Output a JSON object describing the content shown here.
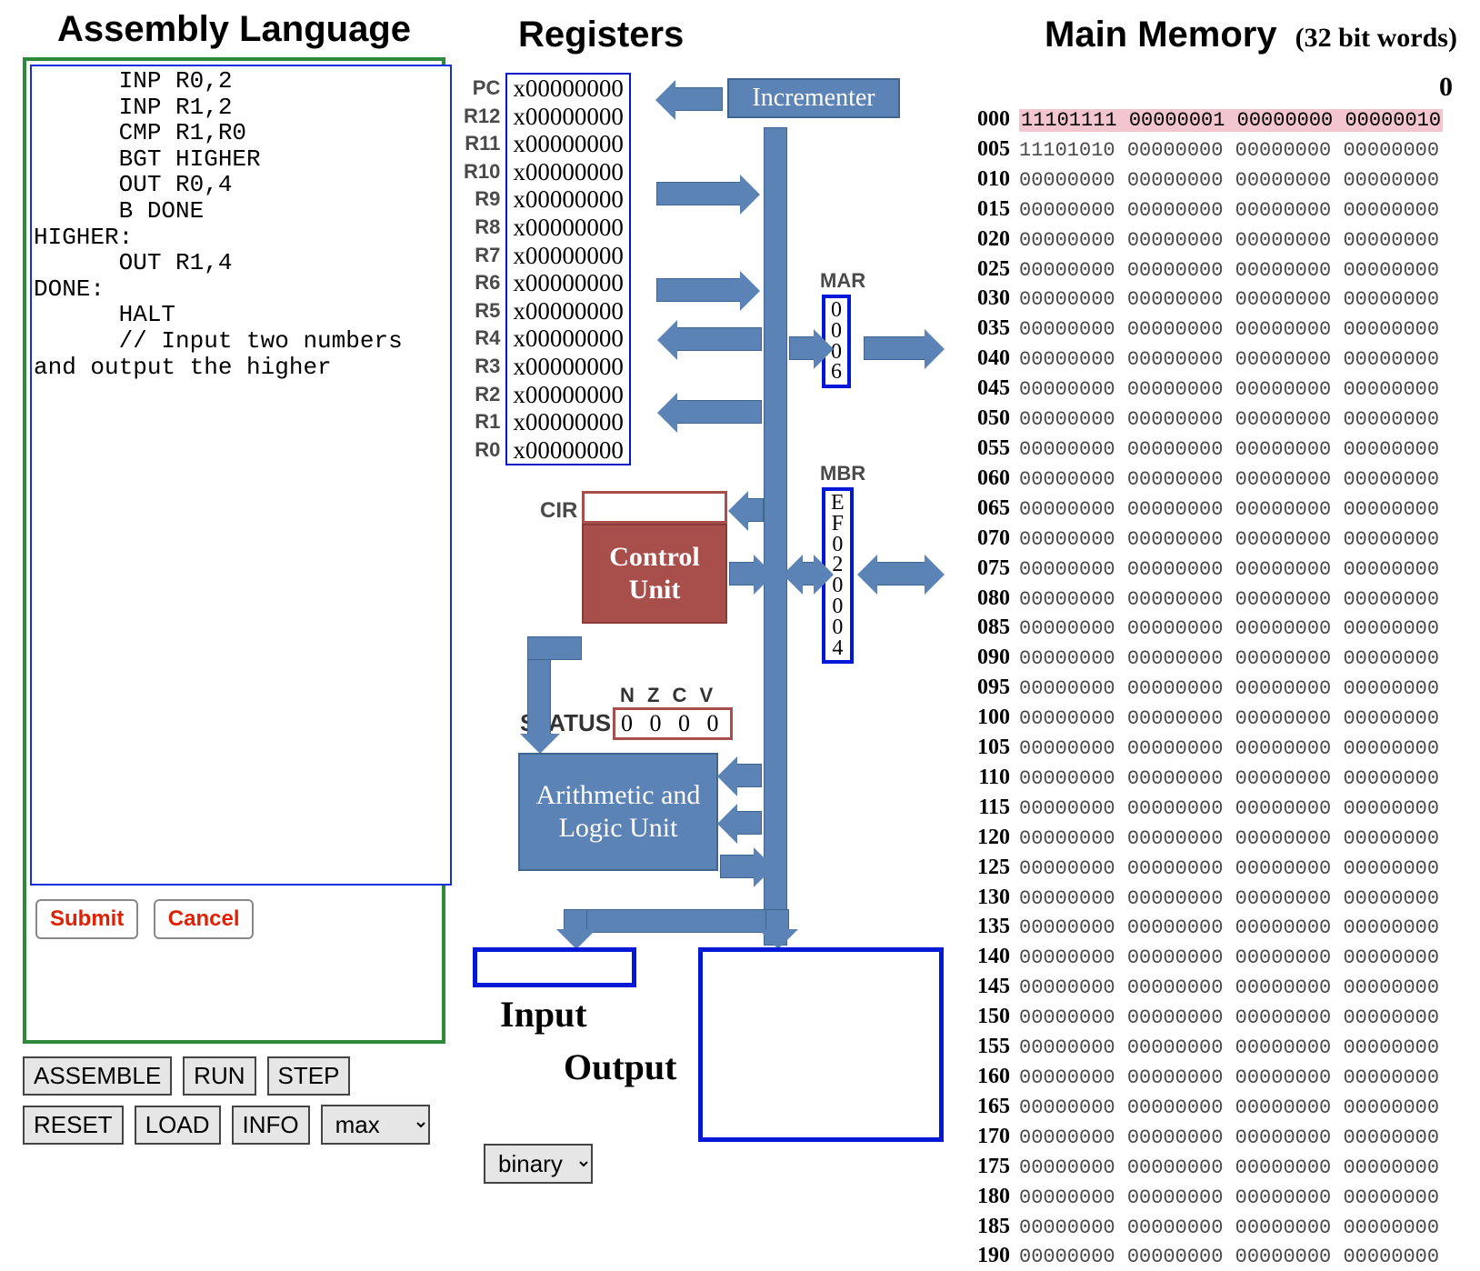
{
  "left": {
    "title": "Assembly Language",
    "code": "      INP R0,2\n      INP R1,2\n      CMP R1,R0\n      BGT HIGHER\n      OUT R0,4\n      B DONE\nHIGHER:\n      OUT R1,4\nDONE:\n      HALT\n      // Input two numbers\nand output the higher",
    "submit": "Submit",
    "cancel": "Cancel",
    "assemble": "ASSEMBLE",
    "run": "RUN",
    "step": "STEP",
    "reset": "RESET",
    "load": "LOAD",
    "info": "INFO",
    "speed_selected": "max"
  },
  "registers": {
    "title": "Registers",
    "labels": [
      "PC",
      "R12",
      "R11",
      "R10",
      "R9",
      "R8",
      "R7",
      "R6",
      "R5",
      "R4",
      "R3",
      "R2",
      "R1",
      "R0"
    ],
    "value": "x00000000"
  },
  "cpu": {
    "incrementer": "Incrementer",
    "control_unit": "Control Unit",
    "alu": "Arithmetic and Logic Unit",
    "cir_label": "CIR",
    "cir_value": "",
    "status_label": "STATUS",
    "nzcv_label": "N Z C V",
    "status_value": "0 0 0 0",
    "mar_label": "MAR",
    "mar_value": [
      "0",
      "0",
      "0",
      "6"
    ],
    "mbr_label": "MBR",
    "mbr_value": [
      "E",
      "F",
      "0",
      "2",
      "0",
      "0",
      "0",
      "4"
    ],
    "input_label": "Input",
    "output_label": "Output",
    "format_selected": "binary"
  },
  "memory": {
    "title": "Main Memory",
    "subtitle": "(32 bit words)",
    "col_header": "0",
    "highlight_addr": "000",
    "rows": [
      {
        "addr": "000",
        "vals": "11101111 00000001 00000000 00000010"
      },
      {
        "addr": "005",
        "vals": "11101010 00000000 00000000 00000000"
      },
      {
        "addr": "010",
        "vals": "00000000 00000000 00000000 00000000"
      },
      {
        "addr": "015",
        "vals": "00000000 00000000 00000000 00000000"
      },
      {
        "addr": "020",
        "vals": "00000000 00000000 00000000 00000000"
      },
      {
        "addr": "025",
        "vals": "00000000 00000000 00000000 00000000"
      },
      {
        "addr": "030",
        "vals": "00000000 00000000 00000000 00000000"
      },
      {
        "addr": "035",
        "vals": "00000000 00000000 00000000 00000000"
      },
      {
        "addr": "040",
        "vals": "00000000 00000000 00000000 00000000"
      },
      {
        "addr": "045",
        "vals": "00000000 00000000 00000000 00000000"
      },
      {
        "addr": "050",
        "vals": "00000000 00000000 00000000 00000000"
      },
      {
        "addr": "055",
        "vals": "00000000 00000000 00000000 00000000"
      },
      {
        "addr": "060",
        "vals": "00000000 00000000 00000000 00000000"
      },
      {
        "addr": "065",
        "vals": "00000000 00000000 00000000 00000000"
      },
      {
        "addr": "070",
        "vals": "00000000 00000000 00000000 00000000"
      },
      {
        "addr": "075",
        "vals": "00000000 00000000 00000000 00000000"
      },
      {
        "addr": "080",
        "vals": "00000000 00000000 00000000 00000000"
      },
      {
        "addr": "085",
        "vals": "00000000 00000000 00000000 00000000"
      },
      {
        "addr": "090",
        "vals": "00000000 00000000 00000000 00000000"
      },
      {
        "addr": "095",
        "vals": "00000000 00000000 00000000 00000000"
      },
      {
        "addr": "100",
        "vals": "00000000 00000000 00000000 00000000"
      },
      {
        "addr": "105",
        "vals": "00000000 00000000 00000000 00000000"
      },
      {
        "addr": "110",
        "vals": "00000000 00000000 00000000 00000000"
      },
      {
        "addr": "115",
        "vals": "00000000 00000000 00000000 00000000"
      },
      {
        "addr": "120",
        "vals": "00000000 00000000 00000000 00000000"
      },
      {
        "addr": "125",
        "vals": "00000000 00000000 00000000 00000000"
      },
      {
        "addr": "130",
        "vals": "00000000 00000000 00000000 00000000"
      },
      {
        "addr": "135",
        "vals": "00000000 00000000 00000000 00000000"
      },
      {
        "addr": "140",
        "vals": "00000000 00000000 00000000 00000000"
      },
      {
        "addr": "145",
        "vals": "00000000 00000000 00000000 00000000"
      },
      {
        "addr": "150",
        "vals": "00000000 00000000 00000000 00000000"
      },
      {
        "addr": "155",
        "vals": "00000000 00000000 00000000 00000000"
      },
      {
        "addr": "160",
        "vals": "00000000 00000000 00000000 00000000"
      },
      {
        "addr": "165",
        "vals": "00000000 00000000 00000000 00000000"
      },
      {
        "addr": "170",
        "vals": "00000000 00000000 00000000 00000000"
      },
      {
        "addr": "175",
        "vals": "00000000 00000000 00000000 00000000"
      },
      {
        "addr": "180",
        "vals": "00000000 00000000 00000000 00000000"
      },
      {
        "addr": "185",
        "vals": "00000000 00000000 00000000 00000000"
      },
      {
        "addr": "190",
        "vals": "00000000 00000000 00000000 00000000"
      }
    ]
  }
}
